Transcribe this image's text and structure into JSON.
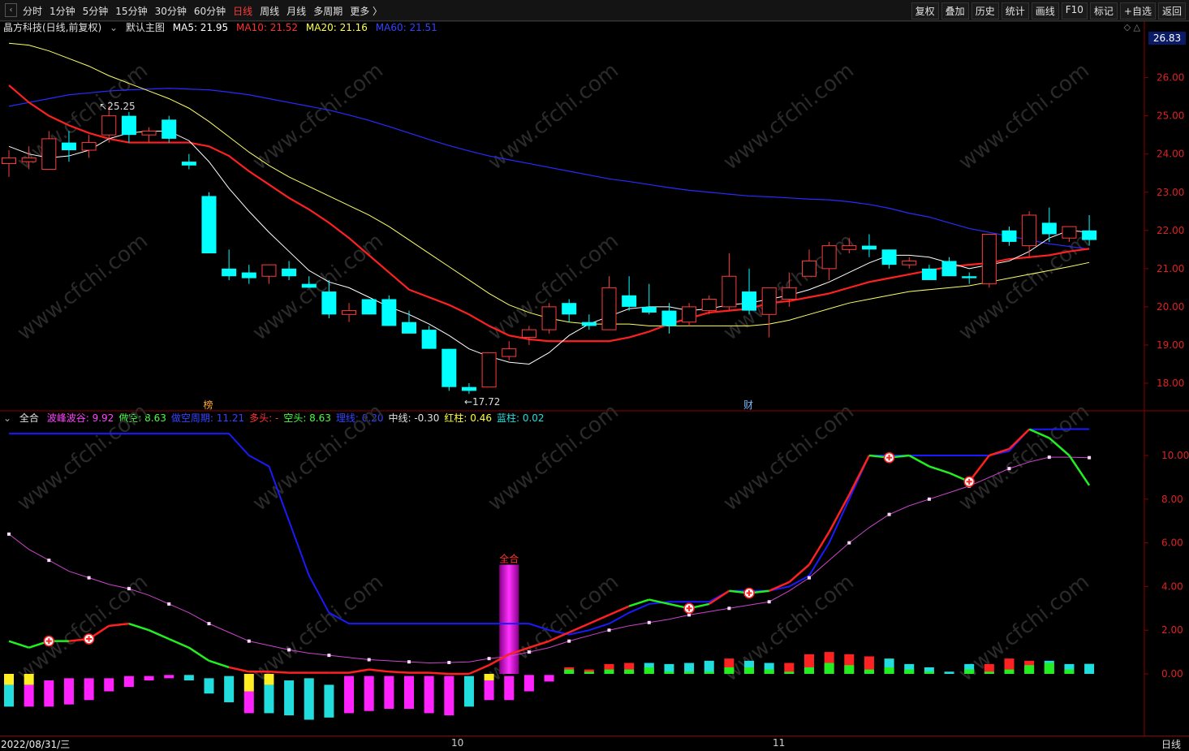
{
  "toolbar": {
    "periods": [
      "分时",
      "1分钟",
      "5分钟",
      "15分钟",
      "30分钟",
      "60分钟",
      "日线",
      "周线",
      "月线",
      "多周期",
      "更多 〉"
    ],
    "active_period": "日线",
    "right_buttons": [
      "复权",
      "叠加",
      "历史",
      "统计",
      "画线",
      "F10",
      "标记",
      "+自选",
      "返回"
    ]
  },
  "main_legend": {
    "stock": "晶方科技(日线,前复权)",
    "template": "默认主图",
    "ma5": "MA5: 21.95",
    "ma10": "MA10: 21.52",
    "ma20": "MA20: 21.16",
    "ma60": "MA60: 21.51"
  },
  "price_tag": "26.83",
  "price_axis": [
    "26.00",
    "25.00",
    "24.00",
    "23.00",
    "22.00",
    "21.00",
    "20.00",
    "19.00",
    "18.00"
  ],
  "price_annotations": {
    "high": "25.25",
    "low": "17.72"
  },
  "event_marks": [
    "榜",
    "财"
  ],
  "ind_legend": {
    "name": "全合",
    "items": [
      {
        "text": "波峰波谷: 9.92",
        "color": "#ff44ff"
      },
      {
        "text": "做空: 8.63",
        "color": "#44ff44"
      },
      {
        "text": "做空周期: 11.21",
        "color": "#3344ff"
      },
      {
        "text": "多头: -",
        "color": "#ff3333"
      },
      {
        "text": "空头: 8.63",
        "color": "#44ff44"
      },
      {
        "text": "理线: 0.20",
        "color": "#3344ff"
      },
      {
        "text": "中线: -0.30",
        "color": "#e0e0e0"
      },
      {
        "text": "红柱: 0.46",
        "color": "#ffff33"
      },
      {
        "text": "蓝柱: 0.02",
        "color": "#22dddd"
      }
    ]
  },
  "ind_axis": [
    "10.00",
    "8.00",
    "6.00",
    "4.00",
    "2.00",
    "0.00"
  ],
  "quanhe_label": "全合",
  "bottom": {
    "date": "2022/08/31/三",
    "m10": "10",
    "m11": "11",
    "right": "日线"
  },
  "colors": {
    "up": "#ff3b3b",
    "down": "#00ffff",
    "ma5": "#ffffff",
    "ma10": "#ff2020",
    "ma20": "#ffff66",
    "ma60": "#2a2aff"
  },
  "chart_data": {
    "type": "candlestick",
    "candles": [
      [
        23.75,
        23.9,
        24.1,
        23.4
      ],
      [
        23.8,
        23.9,
        24.2,
        23.6
      ],
      [
        23.6,
        24.4,
        24.6,
        23.6
      ],
      [
        24.3,
        24.1,
        24.6,
        23.8
      ],
      [
        24.1,
        24.3,
        24.5,
        23.9
      ],
      [
        24.5,
        25.0,
        25.25,
        24.3
      ],
      [
        25.0,
        24.5,
        25.1,
        24.3
      ],
      [
        24.5,
        24.6,
        24.7,
        24.3
      ],
      [
        24.9,
        24.4,
        25.0,
        24.3
      ],
      [
        23.8,
        23.7,
        24.0,
        23.6
      ],
      [
        22.9,
        21.4,
        23.0,
        21.4
      ],
      [
        21.0,
        20.8,
        21.5,
        20.7
      ],
      [
        20.9,
        20.75,
        21.1,
        20.6
      ],
      [
        20.8,
        21.1,
        21.1,
        20.6
      ],
      [
        21.0,
        20.8,
        21.2,
        20.7
      ],
      [
        20.6,
        20.5,
        20.8,
        20.5
      ],
      [
        20.4,
        19.8,
        20.7,
        19.7
      ],
      [
        19.8,
        19.9,
        20.1,
        19.6
      ],
      [
        20.2,
        19.8,
        20.2,
        19.8
      ],
      [
        20.2,
        19.5,
        20.3,
        19.5
      ],
      [
        19.6,
        19.3,
        19.9,
        19.3
      ],
      [
        19.4,
        18.9,
        19.5,
        18.9
      ],
      [
        18.9,
        17.9,
        18.9,
        17.8
      ],
      [
        17.9,
        17.8,
        18.0,
        17.72
      ],
      [
        17.9,
        18.8,
        18.8,
        17.9
      ],
      [
        18.7,
        18.9,
        19.1,
        18.6
      ],
      [
        19.2,
        19.4,
        19.5,
        19.0
      ],
      [
        19.4,
        20.0,
        20.1,
        19.3
      ],
      [
        20.1,
        19.8,
        20.2,
        19.6
      ],
      [
        19.6,
        19.5,
        19.8,
        19.4
      ],
      [
        19.4,
        20.5,
        20.8,
        19.4
      ],
      [
        20.3,
        20.0,
        20.8,
        19.9
      ],
      [
        20.0,
        19.85,
        20.6,
        19.8
      ],
      [
        19.9,
        19.5,
        20.1,
        19.3
      ],
      [
        19.6,
        20.0,
        20.1,
        19.5
      ],
      [
        19.9,
        20.2,
        20.3,
        19.8
      ],
      [
        20.0,
        20.8,
        21.4,
        19.9
      ],
      [
        20.4,
        19.9,
        21.0,
        19.8
      ],
      [
        19.8,
        20.5,
        20.5,
        19.2
      ],
      [
        20.2,
        20.5,
        20.9,
        20.0
      ],
      [
        20.8,
        21.2,
        21.5,
        20.8
      ],
      [
        21.0,
        21.6,
        21.7,
        20.7
      ],
      [
        21.5,
        21.6,
        21.8,
        21.4
      ],
      [
        21.6,
        21.5,
        21.9,
        21.3
      ],
      [
        21.5,
        21.1,
        21.5,
        21.0
      ],
      [
        21.1,
        21.2,
        21.3,
        21.0
      ],
      [
        21.0,
        20.7,
        21.1,
        20.7
      ],
      [
        21.2,
        20.8,
        21.3,
        20.8
      ],
      [
        20.8,
        20.75,
        20.9,
        20.6
      ],
      [
        20.6,
        21.9,
        21.9,
        20.5
      ],
      [
        22.0,
        21.7,
        22.1,
        21.6
      ],
      [
        21.6,
        22.4,
        22.5,
        21.3
      ],
      [
        22.2,
        21.9,
        22.6,
        21.7
      ],
      [
        21.8,
        22.1,
        22.1,
        21.7
      ],
      [
        22.0,
        21.75,
        22.4,
        21.6
      ]
    ],
    "ma5": [
      24.2,
      24.0,
      23.9,
      23.95,
      24.1,
      24.4,
      24.55,
      24.6,
      24.6,
      24.35,
      23.8,
      23.1,
      22.5,
      21.95,
      21.45,
      20.95,
      20.65,
      20.5,
      20.25,
      20.0,
      19.8,
      19.55,
      19.25,
      18.9,
      18.7,
      18.55,
      18.5,
      18.8,
      19.25,
      19.55,
      19.75,
      19.95,
      20.0,
      20.0,
      19.9,
      19.95,
      20.05,
      20.1,
      20.2,
      20.3,
      20.45,
      20.65,
      20.9,
      21.15,
      21.35,
      21.35,
      21.3,
      21.15,
      21.0,
      21.1,
      21.2,
      21.45,
      21.8,
      22.0,
      21.95
    ],
    "ma10": [
      25.8,
      25.35,
      25.0,
      24.75,
      24.55,
      24.4,
      24.3,
      24.3,
      24.3,
      24.3,
      24.2,
      23.95,
      23.55,
      23.2,
      22.85,
      22.55,
      22.2,
      21.8,
      21.35,
      20.9,
      20.45,
      20.25,
      20.05,
      19.8,
      19.5,
      19.25,
      19.15,
      19.1,
      19.1,
      19.1,
      19.1,
      19.2,
      19.35,
      19.55,
      19.7,
      19.85,
      19.9,
      19.95,
      20.1,
      20.15,
      20.25,
      20.35,
      20.5,
      20.65,
      20.75,
      20.85,
      20.95,
      21.05,
      21.1,
      21.15,
      21.25,
      21.3,
      21.35,
      21.45,
      21.52
    ],
    "ma20": [
      26.9,
      26.85,
      26.7,
      26.5,
      26.3,
      26.05,
      25.85,
      25.65,
      25.45,
      25.2,
      24.85,
      24.45,
      24.05,
      23.7,
      23.4,
      23.15,
      22.9,
      22.65,
      22.4,
      22.1,
      21.75,
      21.4,
      21.05,
      20.7,
      20.35,
      20.05,
      19.85,
      19.7,
      19.6,
      19.55,
      19.55,
      19.55,
      19.5,
      19.5,
      19.5,
      19.5,
      19.5,
      19.5,
      19.55,
      19.65,
      19.8,
      19.95,
      20.1,
      20.2,
      20.3,
      20.4,
      20.45,
      20.5,
      20.55,
      20.65,
      20.75,
      20.85,
      20.95,
      21.05,
      21.16
    ],
    "ma60": [
      25.25,
      25.35,
      25.45,
      25.55,
      25.6,
      25.65,
      25.68,
      25.7,
      25.72,
      25.7,
      25.68,
      25.62,
      25.55,
      25.45,
      25.35,
      25.25,
      25.15,
      25.02,
      24.88,
      24.72,
      24.55,
      24.38,
      24.22,
      24.08,
      23.95,
      23.85,
      23.75,
      23.65,
      23.55,
      23.45,
      23.35,
      23.28,
      23.2,
      23.12,
      23.05,
      23.0,
      22.95,
      22.9,
      22.88,
      22.85,
      22.82,
      22.8,
      22.75,
      22.68,
      22.58,
      22.45,
      22.35,
      22.2,
      22.05,
      21.95,
      21.85,
      21.75,
      21.65,
      21.58,
      21.51
    ],
    "ind_magenta": [
      6.4,
      5.7,
      5.2,
      4.7,
      4.4,
      4.1,
      3.9,
      3.6,
      3.2,
      2.8,
      2.3,
      1.9,
      1.5,
      1.3,
      1.1,
      0.95,
      0.85,
      0.75,
      0.65,
      0.6,
      0.55,
      0.5,
      0.52,
      0.55,
      0.7,
      0.8,
      1.0,
      1.2,
      1.5,
      1.75,
      2.0,
      2.2,
      2.35,
      2.5,
      2.7,
      2.85,
      3.0,
      3.15,
      3.3,
      3.8,
      4.4,
      5.2,
      6.0,
      6.7,
      7.3,
      7.7,
      8.0,
      8.3,
      8.6,
      9.0,
      9.4,
      9.7,
      9.92,
      9.92,
      9.9
    ],
    "ind_line": [
      1.5,
      1.2,
      1.5,
      1.5,
      1.6,
      2.2,
      2.3,
      2.0,
      1.6,
      1.2,
      0.6,
      0.3,
      0.1,
      0.1,
      0.05,
      0.05,
      0.05,
      0.05,
      0.2,
      0.1,
      0.05,
      0.05,
      0.0,
      0.0,
      0.4,
      0.9,
      1.2,
      1.5,
      1.9,
      2.3,
      2.7,
      3.1,
      3.4,
      3.2,
      3.0,
      3.2,
      3.8,
      3.7,
      3.8,
      4.2,
      5.0,
      6.5,
      8.2,
      10.0,
      9.9,
      10.0,
      9.5,
      9.2,
      8.8,
      10.0,
      10.3,
      11.2,
      10.8,
      10.0,
      8.63
    ],
    "ind_red": [
      0,
      0,
      0,
      0,
      1,
      1,
      1,
      0,
      0,
      0,
      0,
      0,
      1,
      1,
      1,
      1,
      1,
      1,
      1,
      1,
      1,
      1,
      1,
      1,
      1,
      1,
      1,
      1,
      1,
      1,
      1,
      1,
      0,
      0,
      0,
      0,
      1,
      0,
      0,
      1,
      1,
      1,
      1,
      1,
      0,
      0,
      0,
      0,
      0,
      1,
      1,
      1,
      0,
      0,
      0
    ],
    "ind_blue": [
      11.0,
      11.0,
      11.0,
      11.0,
      11.0,
      11.0,
      11.0,
      11.0,
      11.0,
      11.0,
      11.0,
      11.0,
      10.0,
      9.5,
      7.0,
      4.5,
      2.8,
      2.3,
      2.3,
      2.3,
      2.3,
      2.3,
      2.3,
      2.3,
      2.3,
      2.3,
      2.3,
      2.0,
      1.8,
      2.0,
      2.3,
      2.8,
      3.2,
      3.3,
      3.3,
      3.3,
      3.8,
      3.8,
      3.8,
      4.0,
      4.5,
      6.0,
      8.0,
      10.0,
      10.0,
      10.0,
      10.0,
      10.0,
      10.0,
      10.0,
      10.2,
      11.2,
      11.2,
      11.21,
      11.21
    ],
    "bars": [
      [
        -0.5,
        -1.5
      ],
      [
        -0.5,
        -1.5
      ],
      [
        -0.3,
        -1.5
      ],
      [
        -0.2,
        -1.4
      ],
      [
        -0.2,
        -1.2
      ],
      [
        -0.2,
        -0.8
      ],
      [
        -0.1,
        -0.6
      ],
      [
        -0.1,
        -0.3
      ],
      [
        -0.05,
        -0.2
      ],
      [
        -0.05,
        -0.3
      ],
      [
        -0.2,
        -0.9
      ],
      [
        -0.1,
        -1.3
      ],
      [
        -0.8,
        -1.8
      ],
      [
        -0.5,
        -1.8
      ],
      [
        -0.3,
        -1.9
      ],
      [
        -0.2,
        -2.1
      ],
      [
        -0.5,
        -2.0
      ],
      [
        -0.1,
        -1.8
      ],
      [
        -0.1,
        -1.7
      ],
      [
        -0.1,
        -1.6
      ],
      [
        -0.1,
        -1.6
      ],
      [
        -0.1,
        -1.8
      ],
      [
        -0.1,
        -1.9
      ],
      [
        -0.1,
        -1.5
      ],
      [
        -0.3,
        -1.2
      ],
      [
        -0.1,
        -1.2
      ],
      [
        -0.05,
        -0.8
      ],
      [
        -0.05,
        -0.35
      ],
      [
        0.2,
        0.3
      ],
      [
        0.1,
        0.2
      ],
      [
        0.2,
        0.45
      ],
      [
        0.2,
        0.5
      ],
      [
        0.3,
        0.5
      ],
      [
        0.1,
        0.45
      ],
      [
        0.1,
        0.5
      ],
      [
        0.1,
        0.6
      ],
      [
        0.3,
        0.7
      ],
      [
        0.3,
        0.6
      ],
      [
        0.2,
        0.5
      ],
      [
        0.1,
        0.5
      ],
      [
        0.3,
        0.9
      ],
      [
        0.5,
        1.0
      ],
      [
        0.4,
        0.9
      ],
      [
        0.2,
        0.8
      ],
      [
        0.3,
        0.7
      ],
      [
        0.2,
        0.45
      ],
      [
        0.1,
        0.3
      ],
      [
        -0.1,
        0.1
      ],
      [
        0.2,
        0.45
      ],
      [
        0.1,
        0.45
      ],
      [
        0.2,
        0.7
      ],
      [
        0.4,
        0.6
      ],
      [
        0.5,
        0.6
      ],
      [
        0.2,
        0.45
      ],
      [
        0.02,
        0.46
      ]
    ],
    "big_bar": {
      "index": 25,
      "value": 5.0
    }
  }
}
